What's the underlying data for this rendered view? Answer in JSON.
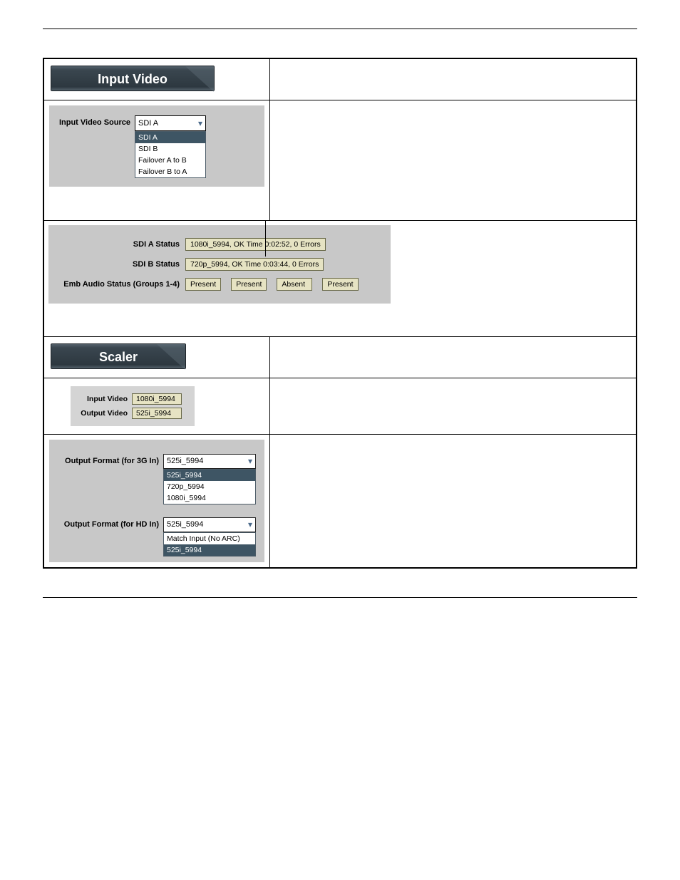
{
  "inputVideo": {
    "header": "Input Video",
    "source": {
      "label": "Input Video Source",
      "value": "SDI A",
      "options": [
        "SDI A",
        "SDI B",
        "Failover A to B",
        "Failover B to A"
      ]
    },
    "status": {
      "sdiA": {
        "label": "SDI A Status",
        "value": "1080i_5994, OK Time 0:02:52, 0 Errors"
      },
      "sdiB": {
        "label": "SDI B Status",
        "value": "720p_5994, OK Time 0:03:44, 0 Errors"
      },
      "embAudio": {
        "label": "Emb Audio Status (Groups 1-4)",
        "groups": [
          "Present",
          "Present",
          "Absent",
          "Present"
        ]
      }
    }
  },
  "scaler": {
    "header": "Scaler",
    "inputVideo": {
      "label": "Input Video",
      "value": "1080i_5994"
    },
    "outputVideo": {
      "label": "Output Video",
      "value": "525i_5994"
    },
    "of3g": {
      "label": "Output Format (for 3G In)",
      "value": "525i_5994",
      "options": [
        "525i_5994",
        "720p_5994",
        "1080i_5994"
      ]
    },
    "ofHd": {
      "label": "Output Format (for HD In)",
      "value": "525i_5994",
      "options": [
        "Match Input (No ARC)",
        "525i_5994"
      ]
    }
  }
}
